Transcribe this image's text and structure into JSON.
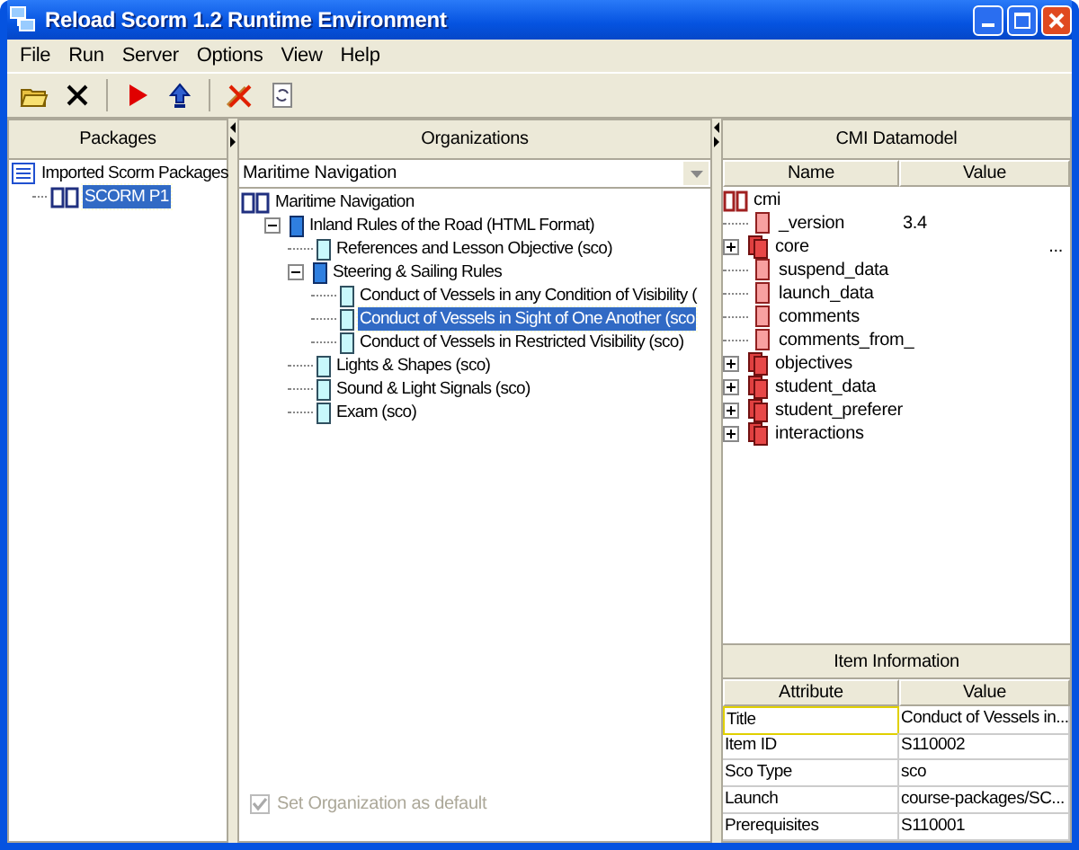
{
  "window": {
    "title": "Reload Scorm 1.2 Runtime Environment"
  },
  "menu": [
    "File",
    "Run",
    "Server",
    "Options",
    "View",
    "Help"
  ],
  "packages": {
    "title": "Packages",
    "tree": [
      {
        "label": "Imported Scorm Packages",
        "selected": false,
        "children": [
          {
            "label": "SCORM P1",
            "selected": true
          }
        ]
      }
    ]
  },
  "organizations": {
    "title": "Organizations",
    "combo_value": "Maritime Navigation",
    "tree": [
      {
        "label": "Maritime Navigation",
        "selected": false,
        "children": [
          {
            "label": "Inland Rules of the Road (HTML Format)",
            "selected": false,
            "expanded": true,
            "children": [
              {
                "label": "References and Lesson Objective (sco)",
                "selected": false
              },
              {
                "label": "Steering & Sailing Rules",
                "selected": false,
                "expanded": true,
                "children": [
                  {
                    "label": "Conduct of Vessels in any Condition of Visibility (",
                    "selected": false
                  },
                  {
                    "label": "Conduct of Vessels in Sight of One Another (sco",
                    "selected": true
                  },
                  {
                    "label": "Conduct of Vessels in Restricted Visibility (sco)",
                    "selected": false
                  }
                ]
              },
              {
                "label": "Lights & Shapes (sco)",
                "selected": false
              },
              {
                "label": "Sound & Light Signals (sco)",
                "selected": false
              },
              {
                "label": "Exam (sco)",
                "selected": false
              }
            ]
          }
        ]
      }
    ],
    "set_default": {
      "label": "Set Organization as default",
      "checked": true,
      "disabled": true
    }
  },
  "cmi": {
    "title": "CMI Datamodel",
    "columns": [
      "Name",
      "Value"
    ],
    "root": "cmi",
    "rows": [
      {
        "name": "_version",
        "value": "3.4",
        "kind": "element"
      },
      {
        "name": "core",
        "value": "...",
        "kind": "group",
        "expanded": false
      },
      {
        "name": "suspend_data",
        "kind": "element"
      },
      {
        "name": "launch_data",
        "kind": "element"
      },
      {
        "name": "comments",
        "kind": "element"
      },
      {
        "name": "comments_from_",
        "kind": "element"
      },
      {
        "name": "objectives",
        "kind": "group",
        "expanded": false
      },
      {
        "name": "student_data",
        "kind": "group",
        "expanded": false
      },
      {
        "name": "student_preferer",
        "kind": "group",
        "expanded": false
      },
      {
        "name": "interactions",
        "kind": "group",
        "expanded": false
      }
    ]
  },
  "item_information": {
    "title": "Item Information",
    "columns": [
      "Attribute",
      "Value"
    ],
    "rows": [
      {
        "attribute": "Title",
        "value": "Conduct of Vessels in...",
        "selected": true
      },
      {
        "attribute": "Item ID",
        "value": "S110002",
        "selected": false
      },
      {
        "attribute": "Sco Type",
        "value": "sco",
        "selected": false
      },
      {
        "attribute": "Launch",
        "value": "course-packages/SC...",
        "selected": false
      },
      {
        "attribute": "Prerequisites",
        "value": "S110001",
        "selected": false
      }
    ]
  }
}
